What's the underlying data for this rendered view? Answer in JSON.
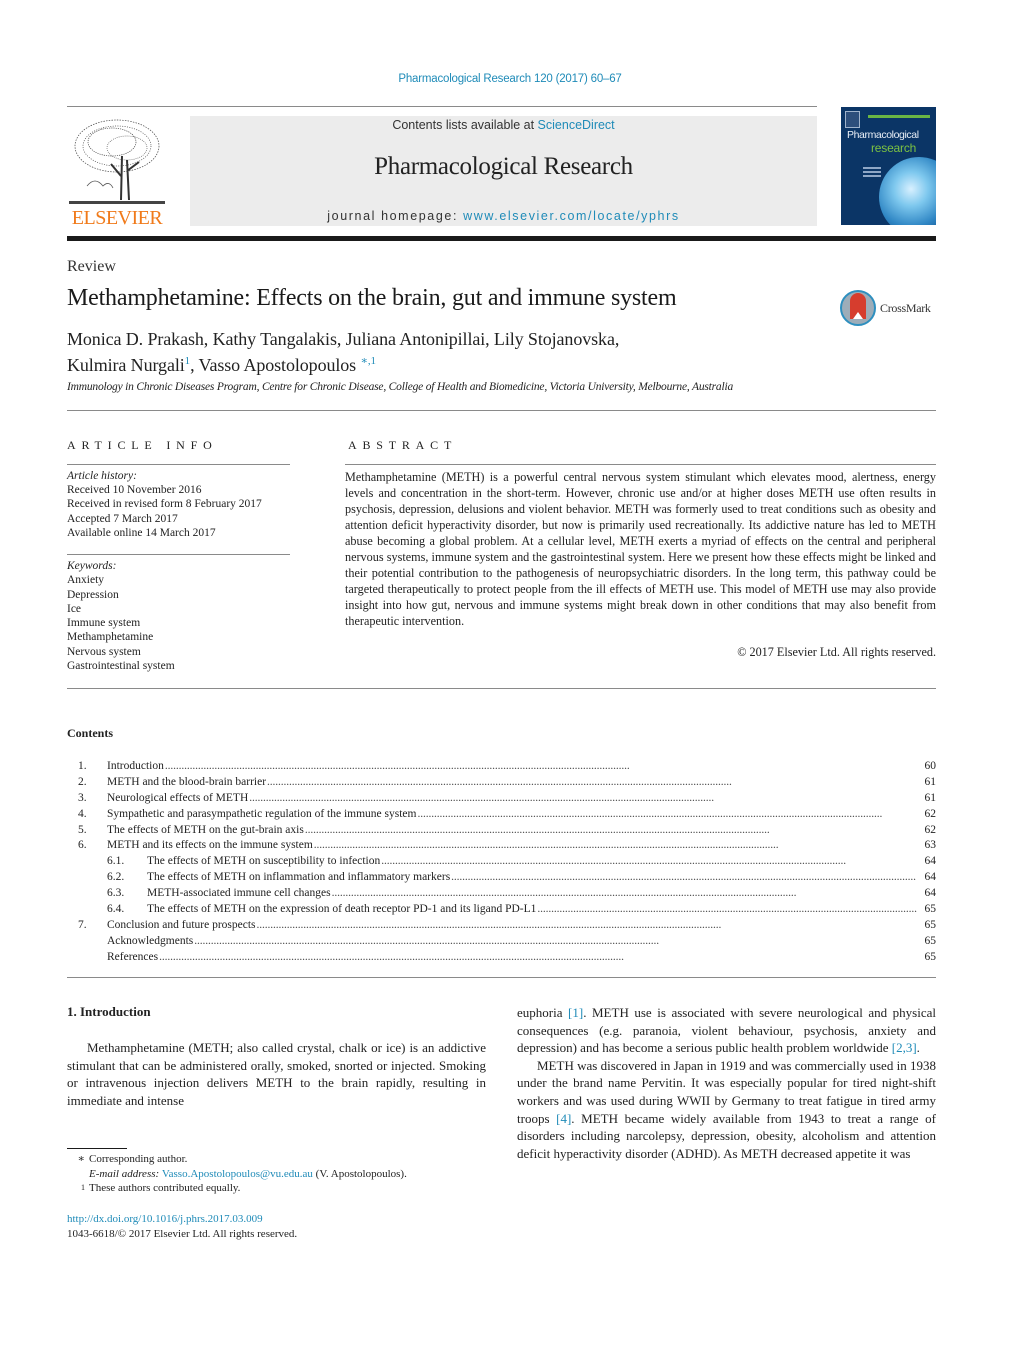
{
  "header": {
    "citation": "Pharmacological Research 120 (2017) 60–67",
    "publisher_logo_text": "ELSEVIER",
    "contents_prefix": "Contents lists available at ",
    "contents_link": "ScienceDirect",
    "journal_title": "Pharmacological Research",
    "homepage_prefix": "journal homepage: ",
    "homepage_link": "www.elsevier.com/locate/yphrs",
    "cover": {
      "line1": "Pharmacological",
      "line2": "research"
    }
  },
  "article": {
    "type": "Review",
    "title": "Methamphetamine: Effects on the brain, gut and immune system",
    "crossmark_label": "CrossMark",
    "authors_line1": "Monica D. Prakash, Kathy Tangalakis, Juliana Antonipillai, Lily Stojanovska,",
    "author_nurgali": "Kulmira Nurgali",
    "author_nurgali_mark": "1",
    "author_sep": ", ",
    "author_apostolopoulos": "Vasso Apostolopoulos",
    "author_apostolopoulos_mark": "∗,1",
    "affiliation": "Immunology in Chronic Diseases Program, Centre for Chronic Disease, College of Health and Biomedicine, Victoria University, Melbourne, Australia"
  },
  "article_info": {
    "heading": "ARTICLE INFO",
    "history_label": "Article history:",
    "history": [
      "Received 10 November 2016",
      "Received in revised form 8 February 2017",
      "Accepted 7 March 2017",
      "Available online 14 March 2017"
    ],
    "keywords_label": "Keywords:",
    "keywords": [
      "Anxiety",
      "Depression",
      "Ice",
      "Immune system",
      "Methamphetamine",
      "Nervous system",
      "Gastrointestinal system"
    ]
  },
  "abstract": {
    "heading": "ABSTRACT",
    "text": "Methamphetamine (METH) is a powerful central nervous system stimulant which elevates mood, alertness, energy levels and concentration in the short-term. However, chronic use and/or at higher doses METH use often results in psychosis, depression, delusions and violent behavior. METH was formerly used to treat conditions such as obesity and attention deficit hyperactivity disorder, but now is primarily used recreationally. Its addictive nature has led to METH abuse becoming a global problem. At a cellular level, METH exerts a myriad of effects on the central and peripheral nervous systems, immune system and the gastrointestinal system. Here we present how these effects might be linked and their potential contribution to the pathogenesis of neuropsychiatric disorders. In the long term, this pathway could be targeted therapeutically to protect people from the ill effects of METH use. This model of METH use may also provide insight into how gut, nervous and immune systems might break down in other conditions that may also benefit from therapeutic intervention.",
    "copyright": "© 2017 Elsevier Ltd. All rights reserved."
  },
  "contents": {
    "heading": "Contents",
    "items": [
      {
        "num": "1.",
        "label": "Introduction",
        "page": "60",
        "sub": false
      },
      {
        "num": "2.",
        "label": "METH and the blood-brain barrier",
        "page": "61",
        "sub": false
      },
      {
        "num": "3.",
        "label": "Neurological effects of METH",
        "page": "61",
        "sub": false
      },
      {
        "num": "4.",
        "label": "Sympathetic and parasympathetic regulation of the immune system",
        "page": "62",
        "sub": false
      },
      {
        "num": "5.",
        "label": "The effects of METH on the gut-brain axis",
        "page": "62",
        "sub": false
      },
      {
        "num": "6.",
        "label": "METH and its effects on the immune system",
        "page": "63",
        "sub": false
      },
      {
        "num": "6.1.",
        "label": "The effects of METH on susceptibility to infection",
        "page": "64",
        "sub": true
      },
      {
        "num": "6.2.",
        "label": "The effects of METH on inflammation and inflammatory markers",
        "page": "64",
        "sub": true
      },
      {
        "num": "6.3.",
        "label": "METH-associated immune cell changes",
        "page": "64",
        "sub": true
      },
      {
        "num": "6.4.",
        "label": "The effects of METH on the expression of death receptor PD-1 and its ligand PD-L1",
        "page": "65",
        "sub": true
      },
      {
        "num": "7.",
        "label": "Conclusion and future prospects",
        "page": "65",
        "sub": false
      },
      {
        "num": "",
        "label": "Acknowledgments",
        "page": "65",
        "sub": false
      },
      {
        "num": "",
        "label": "References",
        "page": "65",
        "sub": false
      }
    ]
  },
  "body": {
    "section_heading": "1.  Introduction",
    "left_para": "Methamphetamine (METH; also called crystal, chalk or ice) is an addictive stimulant that can be administered orally, smoked, snorted or injected. Smoking or intravenous injection delivers METH to the brain rapidly, resulting in immediate and intense",
    "right_p1_a": "euphoria ",
    "right_p1_ref1": "[1]",
    "right_p1_b": ". METH use is associated with severe neurological and physical consequences (e.g. paranoia, violent behaviour, psychosis, anxiety and depression) and has become a serious public health problem worldwide ",
    "right_p1_ref2": "[2,3]",
    "right_p1_c": ".",
    "right_p2_a": "METH was discovered in Japan in 1919 and was commercially used in 1938 under the brand name Pervitin. It was especially popular for tired night-shift workers and was used during WWII by Germany to treat fatigue in tired army troops ",
    "right_p2_ref": "[4]",
    "right_p2_b": ". METH became widely available from 1943 to treat a range of disorders including narcolepsy, depression, obesity, alcoholism and attention deficit hyperactivity disorder (ADHD). As METH decreased appetite it was"
  },
  "footnotes": {
    "corr_mark": "∗",
    "corr_text": "Corresponding author.",
    "email_label": "E-mail address: ",
    "email": "Vasso.Apostolopoulos@vu.edu.au",
    "email_suffix": " (V. Apostolopoulos).",
    "eq_mark": "1",
    "eq_text": "These authors contributed equally.",
    "doi": "http://dx.doi.org/10.1016/j.phrs.2017.03.009",
    "issn": "1043-6618/© 2017 Elsevier Ltd. All rights reserved."
  },
  "colors": {
    "link": "#1f8bb8",
    "elsevier_orange": "#f07a1a",
    "cover_bg": "#0b3566",
    "cover_green": "#7cc242",
    "crossmark_red": "#d63d2e"
  }
}
